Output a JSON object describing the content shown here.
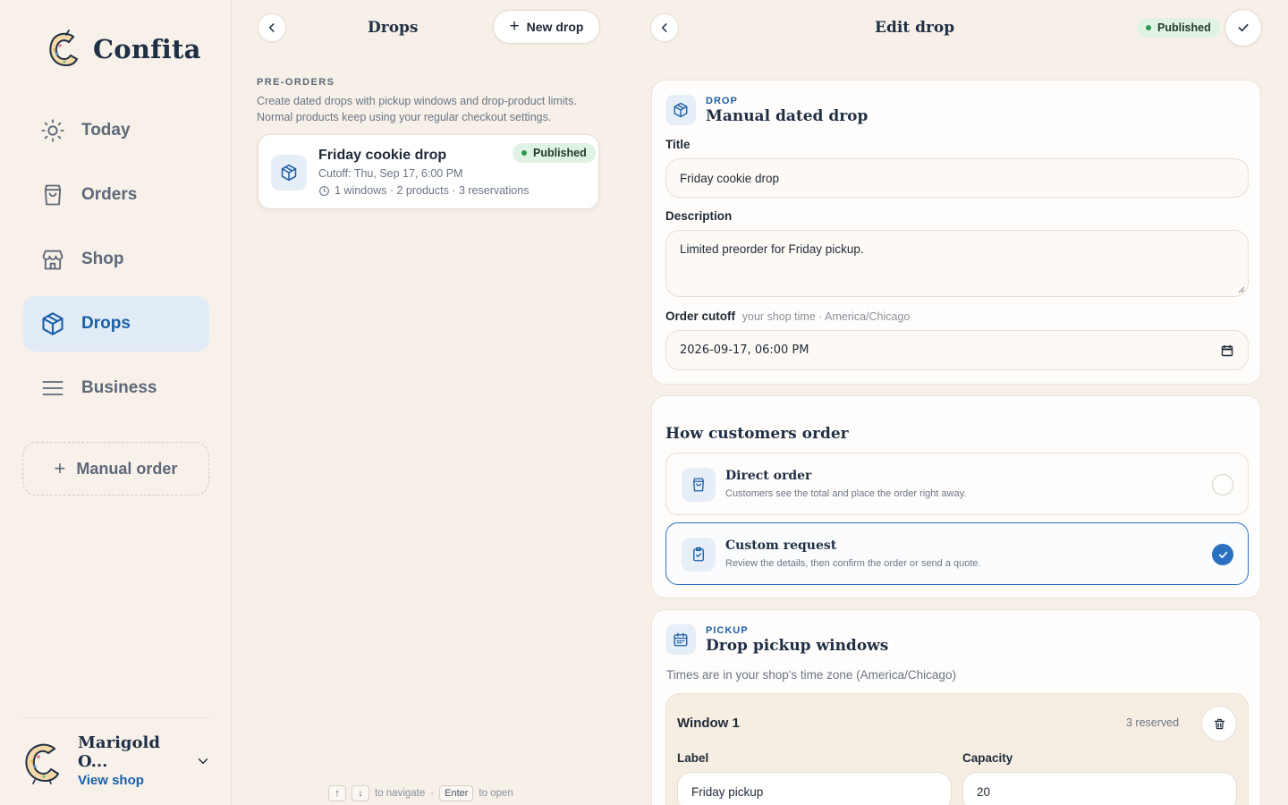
{
  "app": {
    "name": "Confita"
  },
  "sidebar": {
    "items": [
      {
        "label": "Today",
        "icon": "sun-icon"
      },
      {
        "label": "Orders",
        "icon": "bag-icon"
      },
      {
        "label": "Shop",
        "icon": "storefront-icon"
      },
      {
        "label": "Drops",
        "icon": "package-icon",
        "active": true
      },
      {
        "label": "Business",
        "icon": "menu-icon"
      }
    ],
    "manual_order": "Manual order",
    "account": {
      "name": "Marigold O...",
      "link": "View shop"
    }
  },
  "list": {
    "title": "Drops",
    "new_drop": "New drop",
    "section_label": "PRE-ORDERS",
    "section_desc": "Create dated drops with pickup windows and drop-product limits. Normal products keep using your regular checkout settings.",
    "drops": [
      {
        "title": "Friday cookie drop",
        "cutoff": "Cutoff: Thu, Sep 17, 6:00 PM",
        "meta": "1 windows · 2 products · 3 reservations",
        "status": "Published"
      }
    ],
    "hints": {
      "navigate": "to navigate",
      "enter_key": "Enter",
      "open": "to open",
      "separator": "·"
    }
  },
  "edit": {
    "title": "Edit drop",
    "status": "Published",
    "drop_card": {
      "eyebrow": "DROP",
      "heading": "Manual dated drop",
      "title_label": "Title",
      "title_value": "Friday cookie drop",
      "description_label": "Description",
      "description_value": "Limited preorder for Friday pickup.",
      "cutoff_label": "Order cutoff",
      "cutoff_hint": "your shop time · America/Chicago",
      "cutoff_value": "2026-09-17, 06:00 PM"
    },
    "order_mode": {
      "heading": "How customers order",
      "options": [
        {
          "title": "Direct order",
          "desc": "Customers see the total and place the order right away.",
          "selected": false
        },
        {
          "title": "Custom request",
          "desc": "Review the details, then confirm the order or send a quote.",
          "selected": true
        }
      ]
    },
    "pickup": {
      "eyebrow": "PICKUP",
      "heading": "Drop pickup windows",
      "note": "Times are in your shop's time zone (America/Chicago)",
      "windows": [
        {
          "title": "Window 1",
          "reserved": "3 reserved",
          "label_label": "Label",
          "label_value": "Friday pickup",
          "capacity_label": "Capacity",
          "capacity_value": "20"
        }
      ]
    }
  },
  "colors": {
    "accent": "#1b5fa8",
    "success": "#2e9a4f",
    "background": "#f6f0e8"
  }
}
